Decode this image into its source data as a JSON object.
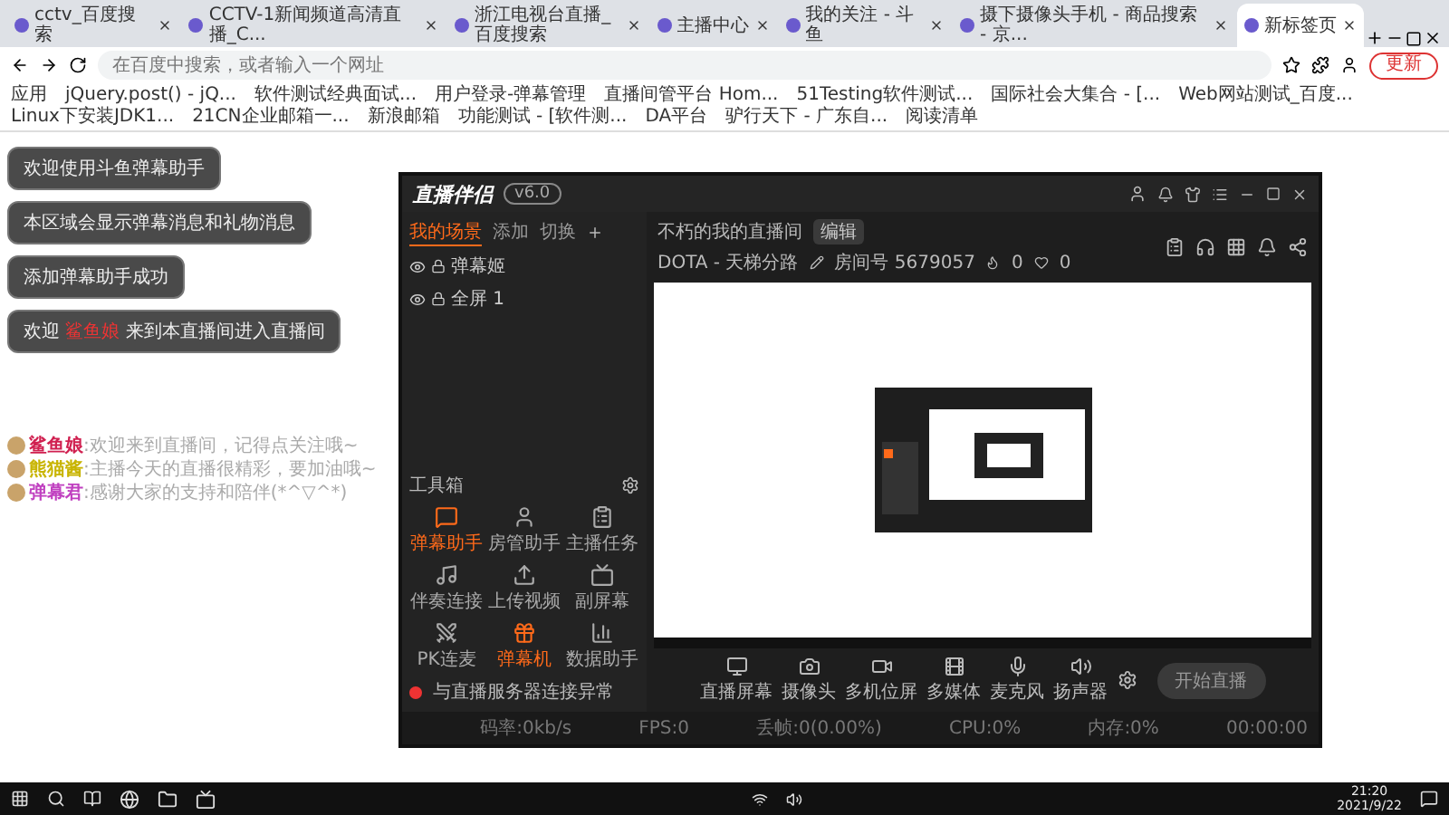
{
  "browser": {
    "tabs": [
      {
        "title": "cctv_百度搜索",
        "selected": false
      },
      {
        "title": "CCTV-1新闻频道高清直播_C...",
        "selected": false
      },
      {
        "title": "浙江电视台直播_百度搜索",
        "selected": false
      },
      {
        "title": "主播中心",
        "selected": false
      },
      {
        "title": "我的关注 - 斗鱼",
        "selected": false
      },
      {
        "title": "摄下摄像头手机 - 商品搜索 - 京...",
        "selected": false
      },
      {
        "title": "新标签页",
        "selected": true
      }
    ],
    "address": {
      "placeholder": "在百度中搜索，或者输入一个网址"
    },
    "update_button": "更新",
    "bookmarks": [
      "应用",
      "jQuery.post() - jQ...",
      "软件测试经典面试...",
      "用户登录-弹幕管理",
      "直播间管平台 Hom...",
      "51Testing软件测试...",
      "国际社会大集合 - [...",
      "Web网站测试_百度...",
      "Linux下安装JDK1...",
      "21CN企业邮箱一...",
      "新浪邮箱",
      "功能测试 - [软件测...",
      "DA平台",
      "驴行天下 - 广东自..."
    ],
    "reading_list": "阅读清单"
  },
  "overlay_messages": [
    {
      "kind": "plain",
      "text": "欢迎使用斗鱼弹幕助手"
    },
    {
      "kind": "plain",
      "text": "本区域会显示弹幕消息和礼物消息"
    },
    {
      "kind": "plain",
      "text": "添加弹幕助手成功"
    },
    {
      "kind": "welcome",
      "prefix": "欢迎",
      "user": "鲨鱼娘",
      "suffix": "来到本直播间进入直播间"
    }
  ],
  "chat": [
    {
      "user": "鲨鱼娘",
      "color": "#d02050",
      "text": ":欢迎来到直播间，记得点关注哦~"
    },
    {
      "user": "熊猫酱",
      "color": "#c8b400",
      "text": ":主播今天的直播很精彩，要加油哦~"
    },
    {
      "user": "弹幕君",
      "color": "#c040c0",
      "text": ":感谢大家的支持和陪伴(*^▽^*)"
    }
  ],
  "app": {
    "logo": "直播伴侣",
    "version": "v6.0",
    "scene_tabs": [
      {
        "label": "我的场景",
        "selected": true
      },
      {
        "label": "添加",
        "selected": false
      },
      {
        "label": "切换",
        "selected": false
      }
    ],
    "sources": [
      {
        "label": "弹幕姬",
        "visible": true
      },
      {
        "label": "全屏 1",
        "visible": true
      }
    ],
    "room_title": "不朽的我的直播间",
    "edit_button": "编辑",
    "category": "DOTA - 天梯分路",
    "room_id": "房间号 5679057",
    "hot": "0",
    "fans": "0",
    "toolbox_title": "工具箱",
    "tools": [
      {
        "label": "弹幕助手",
        "active": true
      },
      {
        "label": "房管助手",
        "active": false
      },
      {
        "label": "主播任务",
        "active": false
      },
      {
        "label": "伴奏连接",
        "active": false
      },
      {
        "label": "上传视频",
        "active": false
      },
      {
        "label": "副屏幕",
        "active": false
      },
      {
        "label": "PK连麦",
        "active": false
      },
      {
        "label": "弹幕机",
        "active": true
      },
      {
        "label": "数据助手",
        "active": false
      }
    ],
    "status_message": "与直播服务器连接异常",
    "controls": [
      "直播屏幕",
      "摄像头",
      "多机位屏",
      "多媒体",
      "麦克风",
      "扬声器"
    ],
    "start_button": "开始直播",
    "stats": [
      "码率:0kb/s",
      "FPS:0",
      "丢帧:0(0.00%)",
      "CPU:0%",
      "内存:0%",
      "00:00:00"
    ]
  },
  "taskbar": {
    "time": "21:20",
    "date": "2021/9/22"
  }
}
